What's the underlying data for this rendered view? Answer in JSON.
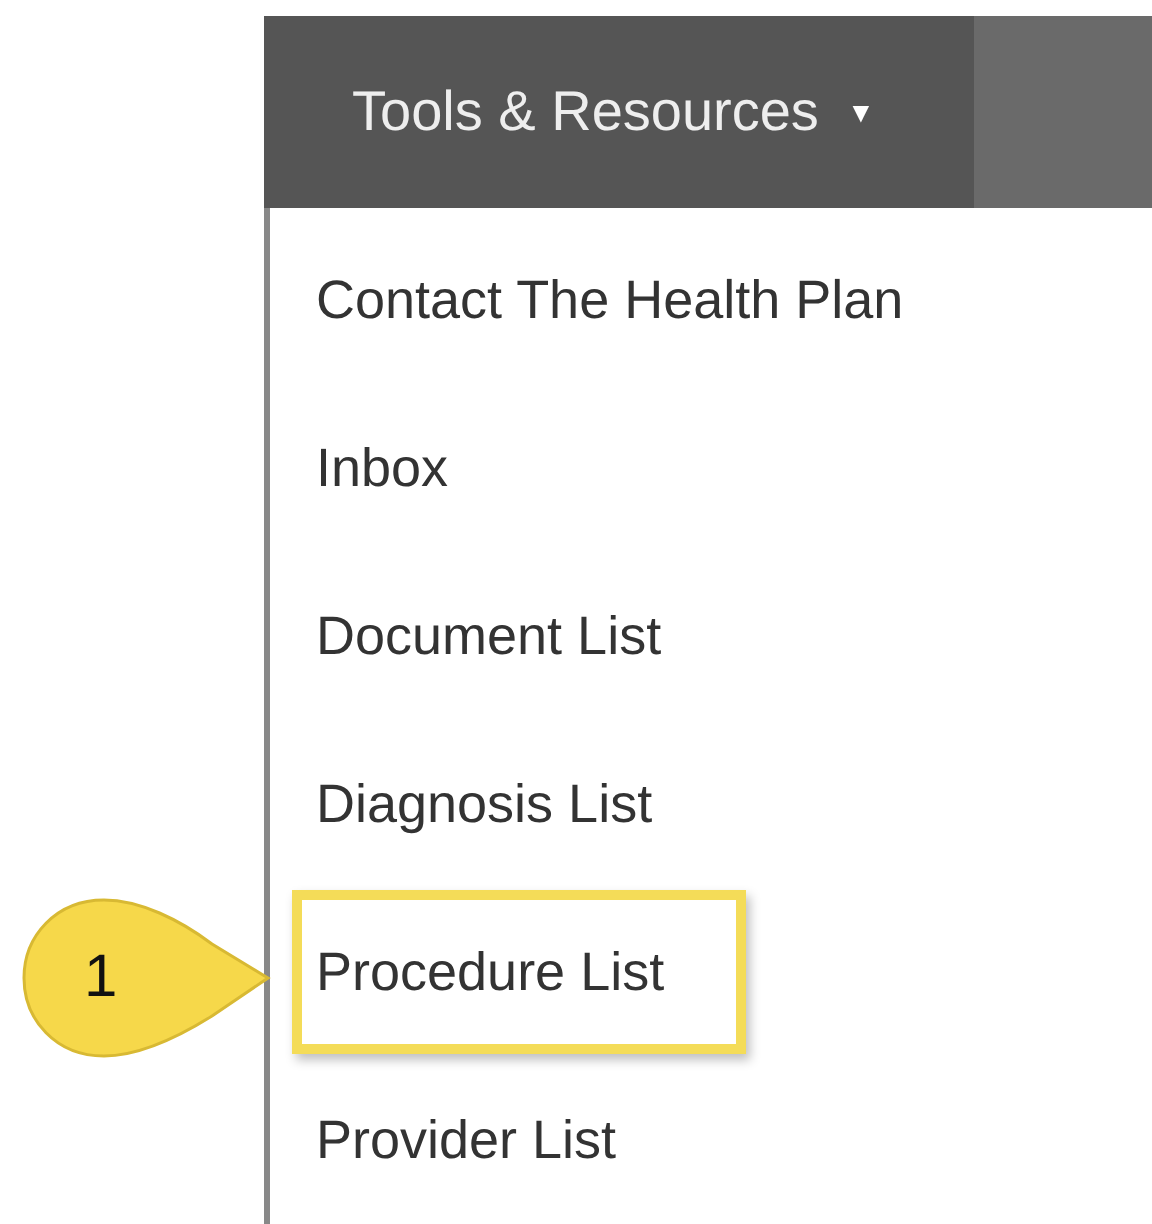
{
  "menu_bar": {
    "title": "Tools & Resources",
    "caret": "▼"
  },
  "dropdown": {
    "items": [
      {
        "label": "Contact The Health Plan",
        "highlighted": false
      },
      {
        "label": "Inbox",
        "highlighted": false
      },
      {
        "label": "Document List",
        "highlighted": false
      },
      {
        "label": "Diagnosis List",
        "highlighted": false
      },
      {
        "label": "Procedure List",
        "highlighted": true
      },
      {
        "label": "Provider List",
        "highlighted": false
      }
    ]
  },
  "callout": {
    "label": "1"
  }
}
